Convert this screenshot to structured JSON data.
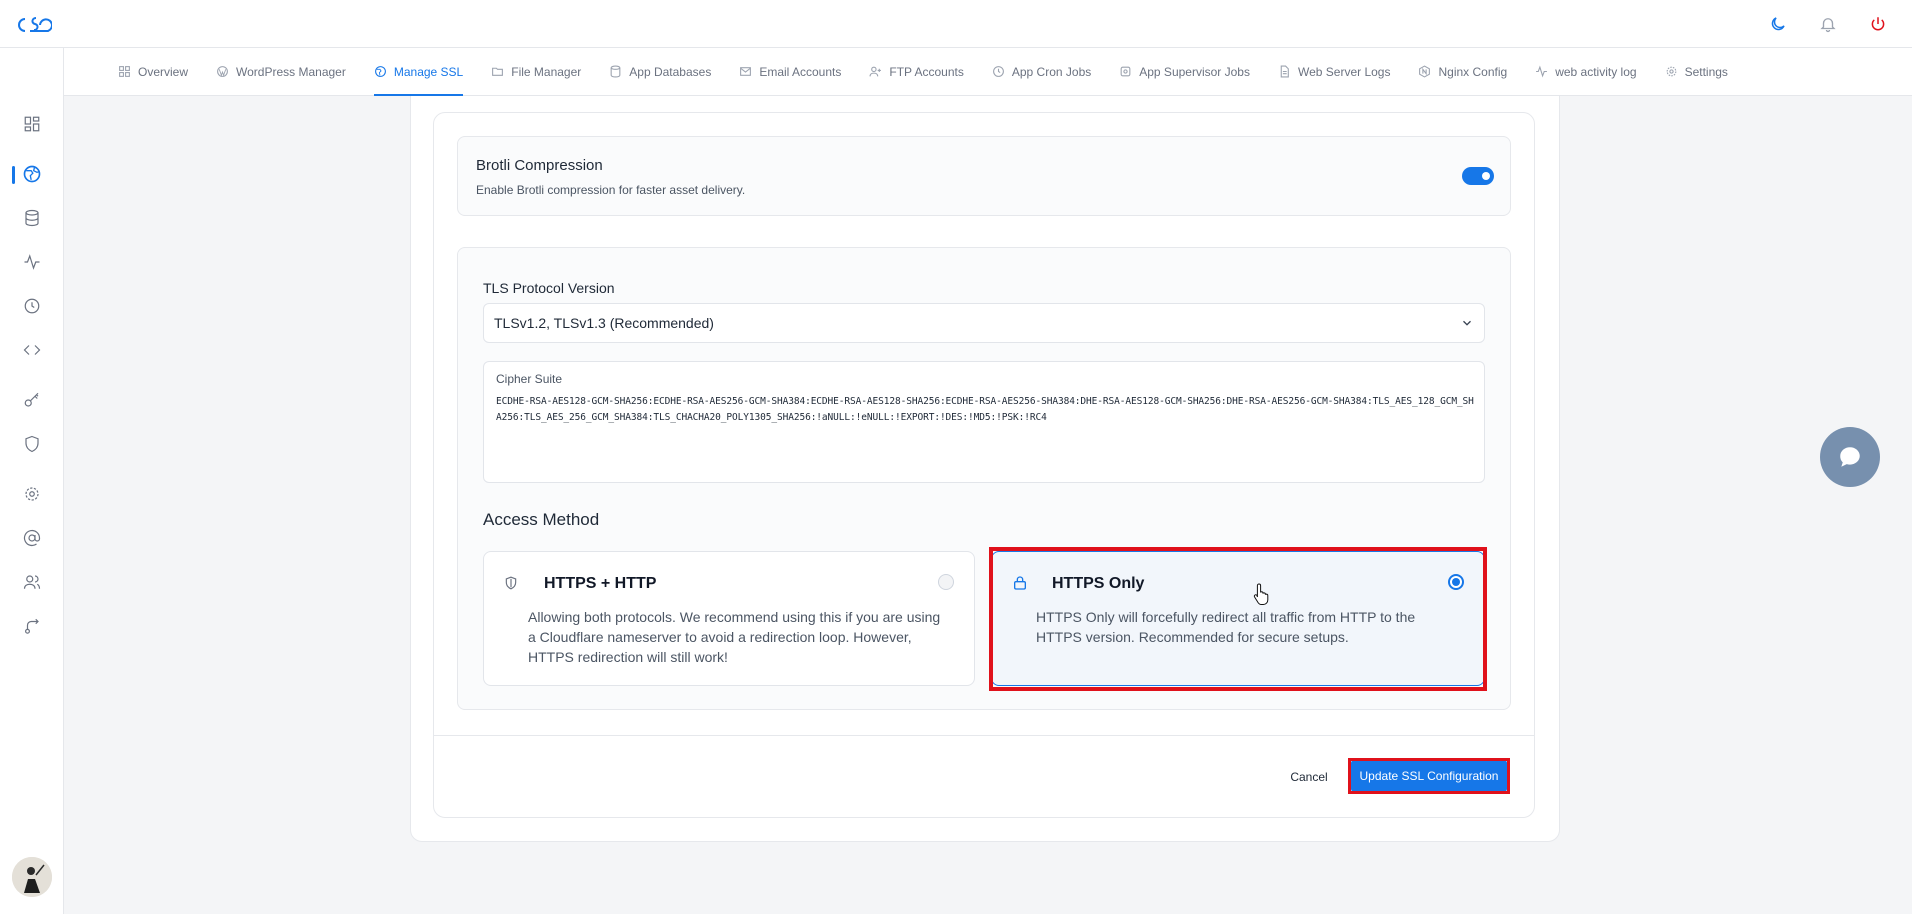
{
  "app": {
    "logo_name": "cs-logo",
    "accent_color": "#1677e8",
    "highlight_color": "#e0111b"
  },
  "topbar": {
    "icons": [
      "moon-icon",
      "bell-icon",
      "power-icon"
    ]
  },
  "sidebar": {
    "items": [
      {
        "icon": "dashboard-icon",
        "active": false
      },
      {
        "icon": "globe-icon",
        "active": true
      },
      {
        "icon": "database-icon",
        "active": false
      },
      {
        "icon": "activity-icon",
        "active": false
      },
      {
        "icon": "clock-icon",
        "active": false
      },
      {
        "icon": "code-icon",
        "active": false
      },
      {
        "icon": "key-icon",
        "active": false
      },
      {
        "icon": "shield-icon",
        "active": false
      },
      {
        "icon": "gear-icon",
        "active": false
      },
      {
        "icon": "at-icon",
        "active": false
      },
      {
        "icon": "users-icon",
        "active": false
      },
      {
        "icon": "route-icon",
        "active": false
      }
    ]
  },
  "tabs": [
    {
      "label": "Overview",
      "icon": "grid-icon",
      "active": false
    },
    {
      "label": "WordPress Manager",
      "icon": "wordpress-icon",
      "active": false
    },
    {
      "label": "Manage SSL",
      "icon": "globe-icon",
      "active": true
    },
    {
      "label": "File Manager",
      "icon": "folder-icon",
      "active": false
    },
    {
      "label": "App Databases",
      "icon": "database-icon",
      "active": false
    },
    {
      "label": "Email Accounts",
      "icon": "mail-icon",
      "active": false
    },
    {
      "label": "FTP Accounts",
      "icon": "user-plus-icon",
      "active": false
    },
    {
      "label": "App Cron Jobs",
      "icon": "clock-icon",
      "active": false
    },
    {
      "label": "App Supervisor Jobs",
      "icon": "cog-icon",
      "active": false
    },
    {
      "label": "Web Server Logs",
      "icon": "file-icon",
      "active": false
    },
    {
      "label": "Nginx Config",
      "icon": "nginx-icon",
      "active": false
    },
    {
      "label": "web activity log",
      "icon": "activity-icon",
      "active": false
    },
    {
      "label": "Settings",
      "icon": "settings-icon",
      "active": false
    }
  ],
  "brotli": {
    "title": "Brotli Compression",
    "description": "Enable Brotli compression for faster asset delivery.",
    "enabled": true
  },
  "tls": {
    "label": "TLS Protocol Version",
    "selected": "TLSv1.2, TLSv1.3 (Recommended)"
  },
  "cipher": {
    "label": "Cipher Suite",
    "value": "ECDHE-RSA-AES128-GCM-SHA256:ECDHE-RSA-AES256-GCM-SHA384:ECDHE-RSA-AES128-SHA256:ECDHE-RSA-AES256-SHA384:DHE-RSA-AES128-GCM-SHA256:DHE-RSA-AES256-GCM-SHA384:TLS_AES_128_GCM_SHA256:TLS_AES_256_GCM_SHA384:TLS_CHACHA20_POLY1305_SHA256:!aNULL:!eNULL:!EXPORT:!DES:!MD5:!PSK:!RC4"
  },
  "access": {
    "title": "Access Method",
    "options": [
      {
        "title": "HTTPS + HTTP",
        "description": "Allowing both protocols. We recommend using this if you are using a Cloudflare nameserver to avoid a redirection loop. However, HTTPS redirection will still work!",
        "icon": "shield-icon",
        "selected": false
      },
      {
        "title": "HTTPS Only",
        "description": "HTTPS Only will forcefully redirect all traffic from HTTP to the HTTPS version. Recommended for secure setups.",
        "icon": "lock-icon",
        "selected": true
      }
    ]
  },
  "actions": {
    "cancel_label": "Cancel",
    "submit_label": "Update SSL Configuration"
  }
}
